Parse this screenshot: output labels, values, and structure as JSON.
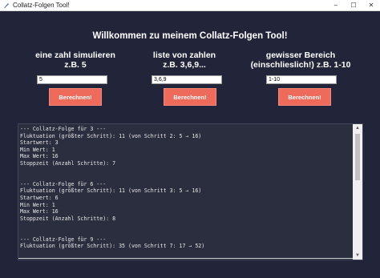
{
  "window": {
    "title": "Collatz-Folgen Tool!",
    "controls": {
      "minimize": "–",
      "maximize": "☐",
      "close": "✕"
    }
  },
  "main": {
    "title": "Willkommen zu meinem Collatz-Folgen Tool!"
  },
  "columns": [
    {
      "heading1": "eine zahl simulieren",
      "heading2": "z.B. 5",
      "input_value": "5",
      "button_label": "Berechnen!"
    },
    {
      "heading1": "liste von zahlen",
      "heading2": "z.B. 3,6,9...",
      "input_value": "3,6,9",
      "button_label": "Berechnen!"
    },
    {
      "heading1": "gewisser Bereich",
      "heading2": "(einschlieslich!) z.B. 1-10",
      "input_value": "1-10",
      "button_label": "Berechnen!"
    }
  ],
  "output": {
    "text": "--- Collatz-Folge für 3 ---\nFluktuation (größter Schritt): 11 (von Schritt 2: 5 → 16)\nStartwert: 3\nMin Wert: 1\nMax Wert: 16\nStoppzeit (Anzahl Schritte): 7\n\n\n--- Collatz-Folge für 6 ---\nFluktuation (größter Schritt): 11 (von Schritt 3: 5 → 16)\nStartwert: 6\nMin Wert: 1\nMax Wert: 16\nStoppzeit (Anzahl Schritte): 8\n\n\n--- Collatz-Folge für 9 ---\nFluktuation (größter Schritt): 35 (von Schritt 7: 17 → 52)"
  },
  "scrollbar": {
    "up": "▲",
    "down": "▼"
  },
  "colors": {
    "background": "#22253a",
    "button": "#ee6a5a",
    "output_bg": "#2b2e3f"
  }
}
